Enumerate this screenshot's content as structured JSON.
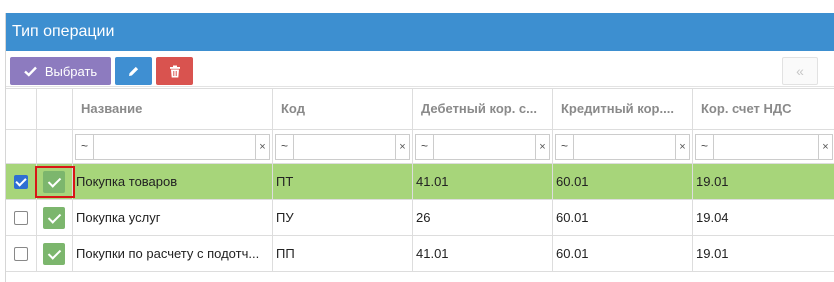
{
  "window": {
    "title": "Тип операции"
  },
  "toolbar": {
    "select_label": "Выбрать",
    "prev_label": "«"
  },
  "columns": [
    "Название",
    "Код",
    "Дебетный кор. с...",
    "Кредитный кор....",
    "Кор. счет НДС"
  ],
  "filters": {
    "operator": "~",
    "clear": "×"
  },
  "rows": [
    {
      "selected": true,
      "name": "Покупка товаров",
      "code": "ПТ",
      "debit": "41.01",
      "credit": "60.01",
      "vat": "19.01"
    },
    {
      "selected": false,
      "name": "Покупка услуг",
      "code": "ПУ",
      "debit": "26",
      "credit": "60.01",
      "vat": "19.04"
    },
    {
      "selected": false,
      "name": "Покупки по расчету с подотч...",
      "code": "ПП",
      "debit": "41.01",
      "credit": "60.01",
      "vat": "19.01"
    }
  ],
  "colors": {
    "title_bar": "#3d8fd0",
    "selected_row": "#a7d57a",
    "select_button": "#8d7bbf",
    "edit_button": "#3f8fd2",
    "delete_button": "#d9534f",
    "highlight": "#d81616"
  },
  "icons": {
    "select": "check-icon",
    "edit": "pencil-icon",
    "delete": "trash-icon",
    "prev": "double-chevron-left-icon",
    "row_status": "check-icon"
  }
}
